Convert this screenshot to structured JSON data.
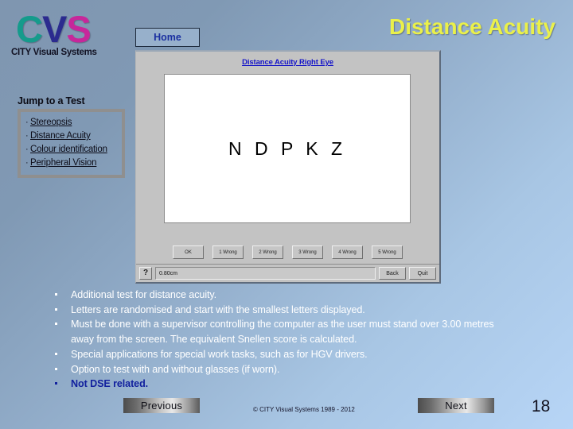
{
  "brand": {
    "logo_c": "C",
    "logo_v": "V",
    "logo_s": "S",
    "subtitle": "CITY Visual Systems"
  },
  "header": {
    "home_label": "Home",
    "title": "Distance Acuity"
  },
  "jump_to_test": {
    "heading": "Jump to a Test",
    "items": [
      {
        "label": "Stereopsis"
      },
      {
        "label": "Distance Acuity"
      },
      {
        "label": "Colour identification"
      },
      {
        "label": "Peripheral Vision"
      }
    ]
  },
  "app_screenshot": {
    "caption": "Distance Acuity Right Eye",
    "chart_letters": "N D P K Z",
    "answer_buttons": [
      "OK",
      "1 Wrong",
      "2 Wrong",
      "3 Wrong",
      "4 Wrong",
      "5 Wrong"
    ],
    "status": {
      "help_icon": "?",
      "value": "0.80cm",
      "back_label": "Back",
      "quit_label": "Quit"
    }
  },
  "bullets": [
    {
      "text": "Additional test for distance acuity.",
      "accent": false
    },
    {
      "text": "Letters are randomised and start with the smallest letters displayed.",
      "accent": false
    },
    {
      "text": "Must be done with a supervisor controlling the computer as the user must stand over 3.00 metres away from the screen. The equivalent Snellen score is calculated.",
      "accent": false
    },
    {
      "text": "Special applications for special work tasks, such as for HGV drivers.",
      "accent": false
    },
    {
      "text": "Option to test with and without glasses (if worn).",
      "accent": false
    },
    {
      "text": "Not DSE related.",
      "accent": true
    }
  ],
  "footer": {
    "previous_label": "Previous",
    "next_label": "Next",
    "copyright": "© CITY Visual Systems 1989 - 2012",
    "page_number": "18"
  },
  "colors": {
    "title_yellow": "#eaf04a",
    "accent_blue": "#12219e",
    "link_blue": "#1414c8",
    "logo_c": "#159b8c",
    "logo_v": "#2b2b8f",
    "logo_s": "#c7279b"
  }
}
